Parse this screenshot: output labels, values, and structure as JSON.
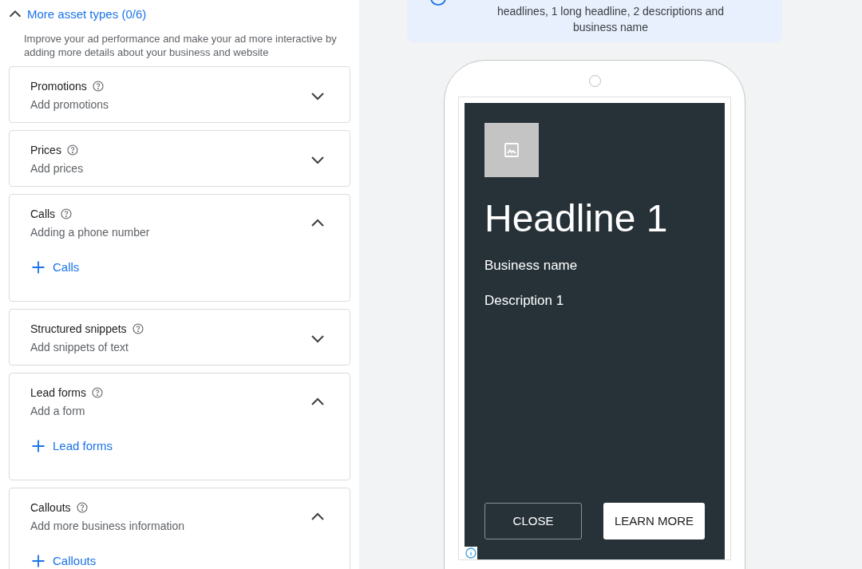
{
  "section": {
    "title": "More asset types (0/6)",
    "expanded": true,
    "description": "Improve your ad performance and make your ad more interactive by adding more details about your business and website"
  },
  "assets": [
    {
      "title": "Promotions",
      "subtitle": "Add promotions",
      "expanded": false
    },
    {
      "title": "Prices",
      "subtitle": "Add prices",
      "expanded": false
    },
    {
      "title": "Calls",
      "subtitle": "Adding a phone number",
      "expanded": true,
      "action": "Calls"
    },
    {
      "title": "Structured snippets",
      "subtitle": "Add snippets of text",
      "expanded": false
    },
    {
      "title": "Lead forms",
      "subtitle": "Add a form",
      "expanded": true,
      "action": "Lead forms"
    },
    {
      "title": "Callouts",
      "subtitle": "Add more business information",
      "expanded": true,
      "action": "Callouts"
    }
  ],
  "notice": {
    "text": "headlines, 1 long headline, 2 descriptions and business name"
  },
  "preview": {
    "headline": "Headline 1",
    "business_name": "Business name",
    "description": "Description 1",
    "buttons": [
      {
        "label": "CLOSE",
        "kind": "outline"
      },
      {
        "label": "LEARN MORE",
        "kind": "filled"
      }
    ]
  }
}
